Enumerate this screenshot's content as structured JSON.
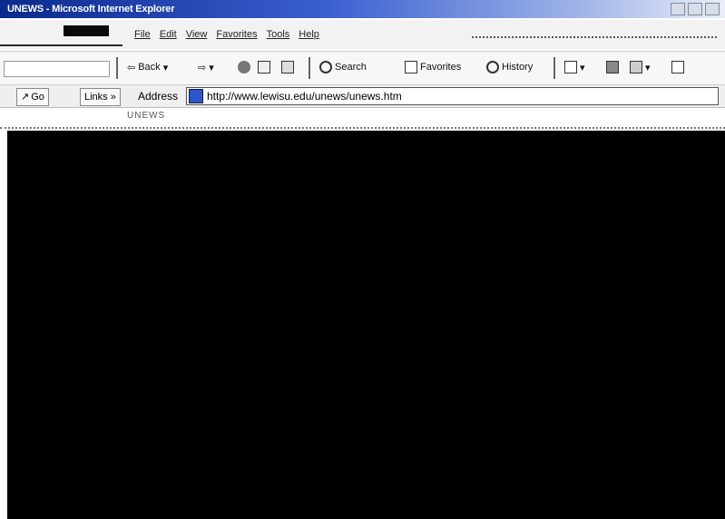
{
  "window": {
    "title": "UNEWS - Microsoft Internet Explorer"
  },
  "menubar": {
    "items": [
      "File",
      "Edit",
      "View",
      "Favorites",
      "Tools",
      "Help"
    ]
  },
  "toolbar": {
    "back_label": "Back",
    "search_label": "Search",
    "favorites_label": "Favorites",
    "history_label": "History"
  },
  "address_bar": {
    "go_label": "Go",
    "links_label": "Links",
    "links_chevron": "»",
    "address_label": "Address",
    "url": "http://www.lewisu.edu/unews/unews.htm"
  },
  "page": {
    "header_fragment": "UNEWS"
  },
  "colors": {
    "titlebar_start": "#0a2a8c",
    "content_bg": "#000000"
  }
}
